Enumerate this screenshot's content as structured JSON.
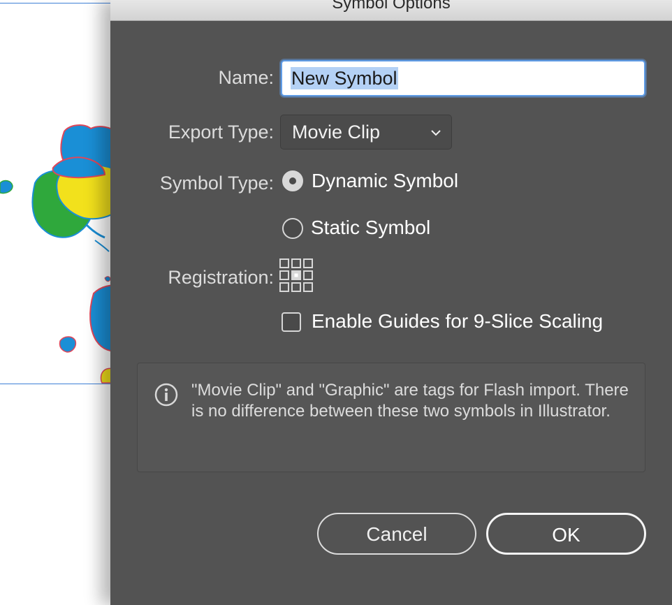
{
  "dialog": {
    "title": "Symbol Options",
    "name_label": "Name:",
    "name_value": "New Symbol",
    "export_type_label": "Export Type:",
    "export_type_value": "Movie Clip",
    "symbol_type_label": "Symbol Type:",
    "symbol_type_options": [
      {
        "label": "Dynamic Symbol",
        "selected": true
      },
      {
        "label": "Static Symbol",
        "selected": false
      }
    ],
    "registration_label": "Registration:",
    "registration_selected": "center",
    "nine_slice_label": "Enable Guides for 9-Slice Scaling",
    "nine_slice_checked": false,
    "info_text": "\"Movie Clip\" and \"Graphic\" are tags for Flash import. There is no difference between these two symbols in Illustrator.",
    "cancel_label": "Cancel",
    "ok_label": "OK"
  },
  "icons": {
    "export_dropdown": "chevron-down-icon",
    "info": "info-icon",
    "registration": "registration-grid-icon"
  },
  "colors": {
    "dialog_bg": "#535353",
    "focus_ring": "#5f9ce6",
    "selection": "#b4d1f5",
    "artboard_border": "#3d7fd6",
    "splat_blue": "#1a8fd6",
    "splat_green": "#2fa83c",
    "splat_yellow": "#f2e11c",
    "splat_outline": "#e0475a"
  }
}
